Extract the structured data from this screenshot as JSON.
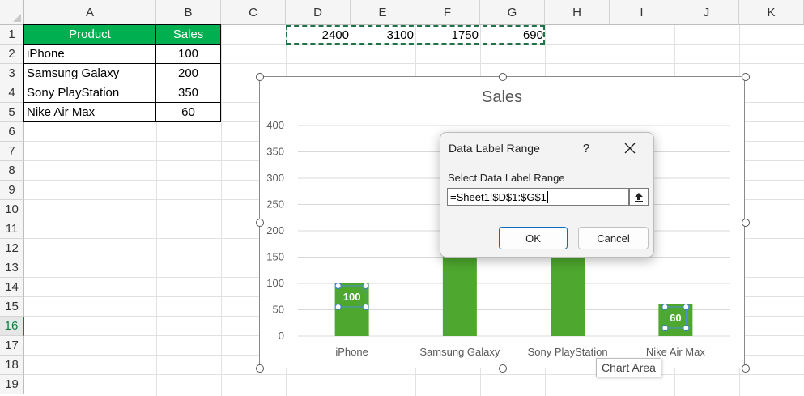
{
  "columns": [
    "A",
    "B",
    "C",
    "D",
    "E",
    "F",
    "G",
    "H",
    "I",
    "J",
    "K"
  ],
  "rows": [
    "1",
    "2",
    "3",
    "4",
    "5",
    "6",
    "7",
    "8",
    "9",
    "10",
    "11",
    "12",
    "13",
    "14",
    "15",
    "16",
    "17",
    "18",
    "19"
  ],
  "selected_row": "16",
  "table": {
    "header": [
      "Product",
      "Sales"
    ],
    "rows": [
      {
        "product": "iPhone",
        "sales": "100"
      },
      {
        "product": "Samsung Galaxy",
        "sales": "200"
      },
      {
        "product": "Sony PlayStation",
        "sales": "350"
      },
      {
        "product": "Nike Air Max",
        "sales": "60"
      }
    ]
  },
  "label_range_values": [
    "2400",
    "3100",
    "1750",
    "690"
  ],
  "colors": {
    "header_fill": "#00b050",
    "bar": "#4ea72e",
    "accent": "#107c41",
    "ok_border": "#0f6cbd"
  },
  "chart_data": {
    "type": "bar",
    "title": "Sales",
    "categories": [
      "iPhone",
      "Samsung Galaxy",
      "Sony PlayStation",
      "Nike Air Max"
    ],
    "values": [
      100,
      200,
      350,
      60
    ],
    "ylim": [
      0,
      400
    ],
    "yticks": [
      0,
      50,
      100,
      150,
      200,
      250,
      300,
      350,
      400
    ],
    "visible_data_labels": [
      {
        "category": "iPhone",
        "text": "100"
      },
      {
        "category": "Nike Air Max",
        "text": "60"
      }
    ],
    "grid": true
  },
  "tooltip": "Chart Area",
  "dialog": {
    "title": "Data Label Range",
    "help": "?",
    "prompt": "Select Data Label Range",
    "input_value": "=Sheet1!$D$1:$G$1",
    "ok": "OK",
    "cancel": "Cancel",
    "icons": {
      "close": "close-icon",
      "collapse": "collapse-dialog-icon"
    }
  }
}
